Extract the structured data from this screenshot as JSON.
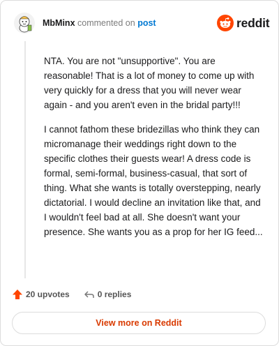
{
  "header": {
    "username": "MbMinx",
    "action_text": "commented on",
    "post_link": "post"
  },
  "logo": {
    "text": "reddit",
    "brand_color": "#ff4500"
  },
  "comment": {
    "paragraphs": [
      "NTA. You are not \"unsupportive\". You are reasonable! That is a lot of money to come up with very quickly for a dress that you will never wear again - and you aren't even in the bridal party!!!",
      "I cannot fathom these bridezillas who think they can micromanage their weddings right down to the specific clothes their guests wear! A dress code is formal, semi-formal, business-casual, that sort of thing. What she wants is totally overstepping, nearly dictatorial. I would decline an invitation like that, and I wouldn't feel bad at all. She doesn't want your presence. She wants you as a prop for her IG feed..."
    ]
  },
  "actions": {
    "upvotes_label": "20 upvotes",
    "replies_label": "0 replies",
    "upvote_color": "#ff4500"
  },
  "footer": {
    "view_more_label": "View more on Reddit",
    "link_color": "#d93a00"
  }
}
